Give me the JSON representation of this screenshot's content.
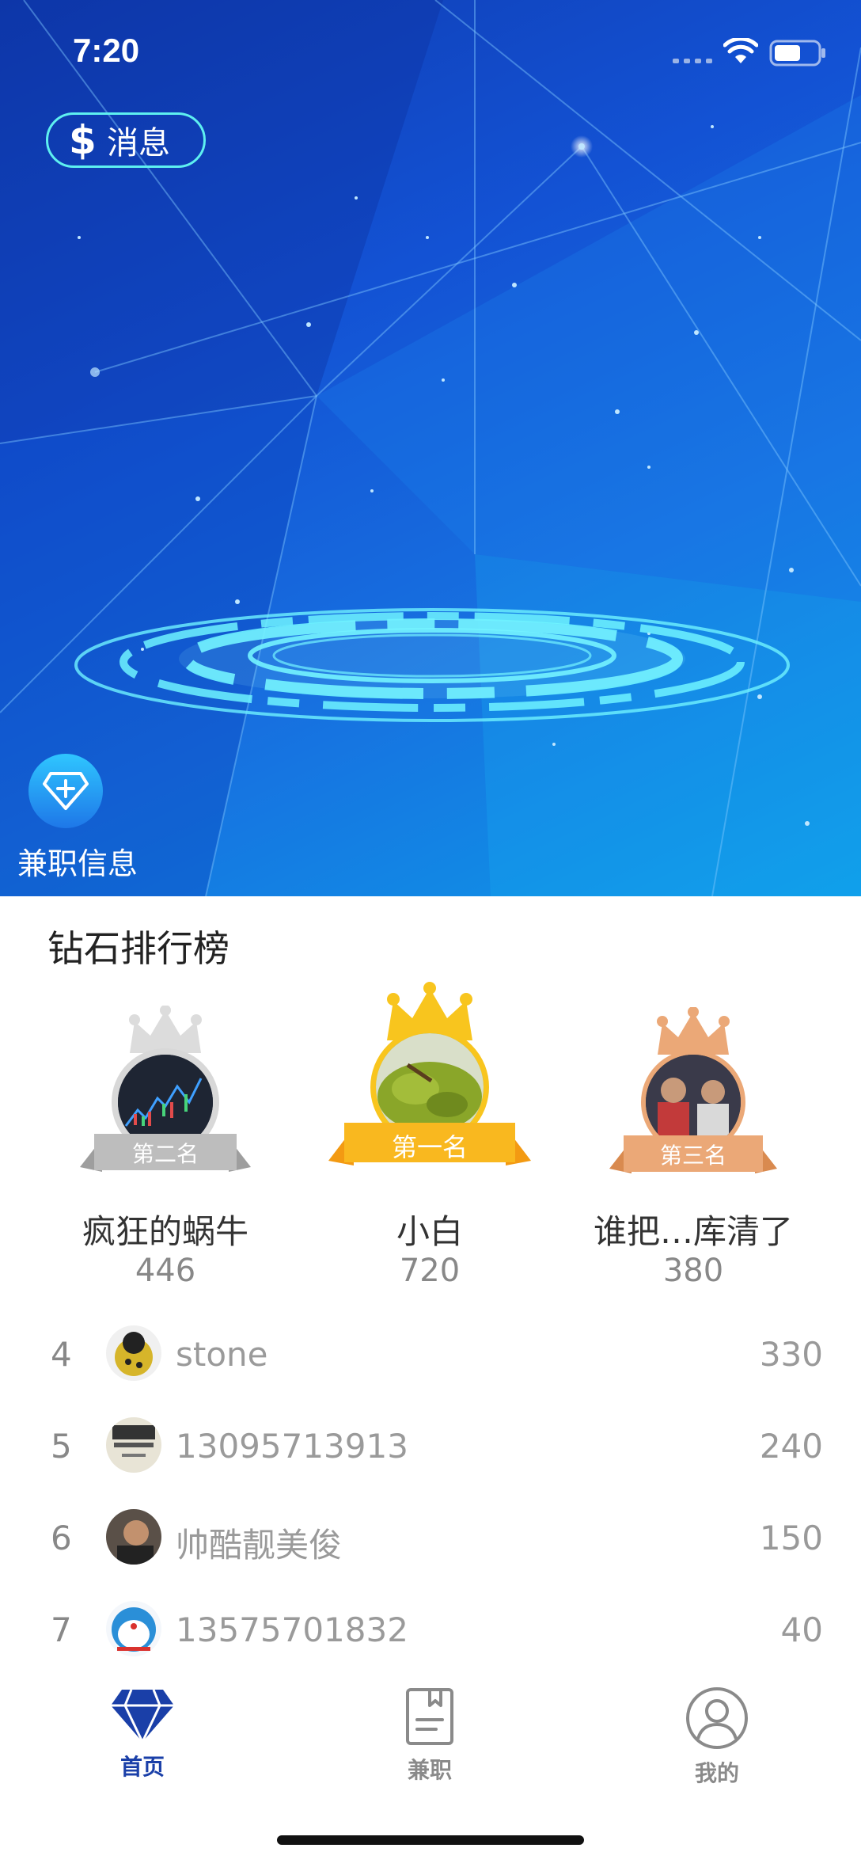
{
  "status_bar": {
    "time": "7:20"
  },
  "header": {
    "message_label": "消息",
    "message_icon": "dollar-icon"
  },
  "hero": {
    "parttime_label": "兼职信息",
    "parttime_icon": "diamond-plus-icon"
  },
  "leaderboard": {
    "title": "钻石排行榜",
    "podium": [
      {
        "place": "第一名",
        "name": "小白",
        "score": "720",
        "ribbon_color": "#f9b81f"
      },
      {
        "place": "第二名",
        "name": "疯狂的蜗牛",
        "score": "446",
        "ribbon_color": "#bdbdbd"
      },
      {
        "place": "第三名",
        "name": "谁把…库清了",
        "score": "380",
        "ribbon_color": "#e9a773"
      }
    ],
    "list": [
      {
        "rank": "4",
        "name": "stone",
        "score": "330"
      },
      {
        "rank": "5",
        "name": "13095713913",
        "score": "240"
      },
      {
        "rank": "6",
        "name": "帅酷靓美俊",
        "score": "150"
      },
      {
        "rank": "7",
        "name": "13575701832",
        "score": "40"
      }
    ]
  },
  "tabbar": {
    "tabs": [
      {
        "label": "首页",
        "icon": "diamond-icon",
        "active": true
      },
      {
        "label": "兼职",
        "icon": "document-icon",
        "active": false
      },
      {
        "label": "我的",
        "icon": "user-icon",
        "active": false
      }
    ],
    "active_color": "#1a3fa8",
    "inactive_color": "#8a8a8a"
  }
}
